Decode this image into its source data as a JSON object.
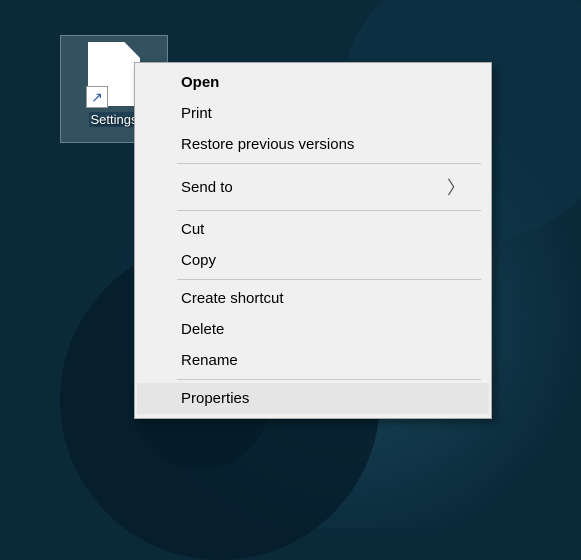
{
  "desktop": {
    "icon_label": "Settings",
    "shortcut_arrow": "↗"
  },
  "context_menu": {
    "items": {
      "open": "Open",
      "print": "Print",
      "restore": "Restore previous versions",
      "send_to": "Send to",
      "cut": "Cut",
      "copy": "Copy",
      "create_shortcut": "Create shortcut",
      "delete": "Delete",
      "rename": "Rename",
      "properties": "Properties"
    }
  }
}
